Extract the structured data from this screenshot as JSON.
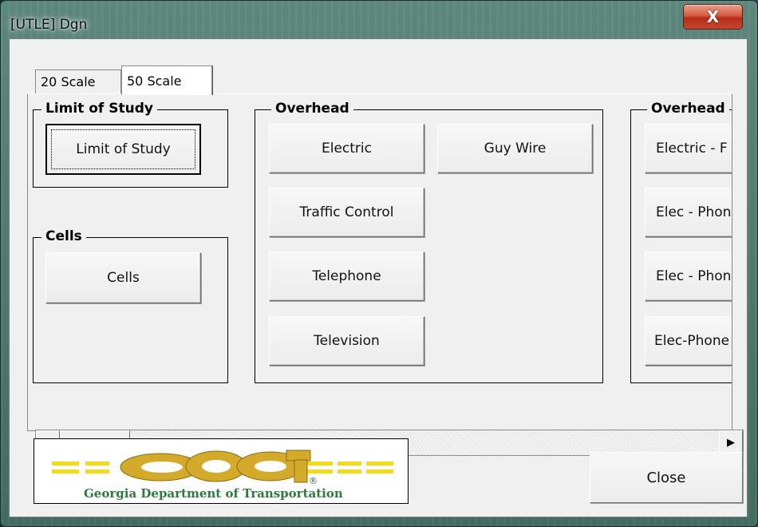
{
  "window": {
    "title": "[UTLE] Dgn",
    "close_glyph": "X"
  },
  "tabs": [
    {
      "label": "20 Scale"
    },
    {
      "label": "50 Scale"
    }
  ],
  "groups": {
    "limit_of_study": {
      "label": "Limit of Study",
      "buttons": [
        "Limit of Study"
      ]
    },
    "cells": {
      "label": "Cells",
      "buttons": [
        "Cells"
      ]
    },
    "overhead": {
      "label": "Overhead",
      "buttons": [
        "Electric",
        "Guy Wire",
        "Traffic Control",
        "Telephone",
        "Television"
      ]
    },
    "overhead2": {
      "label": "Overhead",
      "buttons": [
        "Electric - F",
        "Elec - Phon",
        "Elec - Phon",
        "Elec-Phone"
      ]
    }
  },
  "scrollbar": {
    "left_arrow": "◀",
    "right_arrow": "▶"
  },
  "logo": {
    "wordmark": "GDOT",
    "registered": "®",
    "tagline": "Georgia Department of Transportation"
  },
  "footer": {
    "close_label": "Close"
  },
  "colors": {
    "logo_gold": "#d4aa2a",
    "logo_yellow": "#f2dc17",
    "logo_green": "#2e7a3c",
    "title_close_red": "#c8452c",
    "dialog_bg": "#f0f0f0"
  }
}
